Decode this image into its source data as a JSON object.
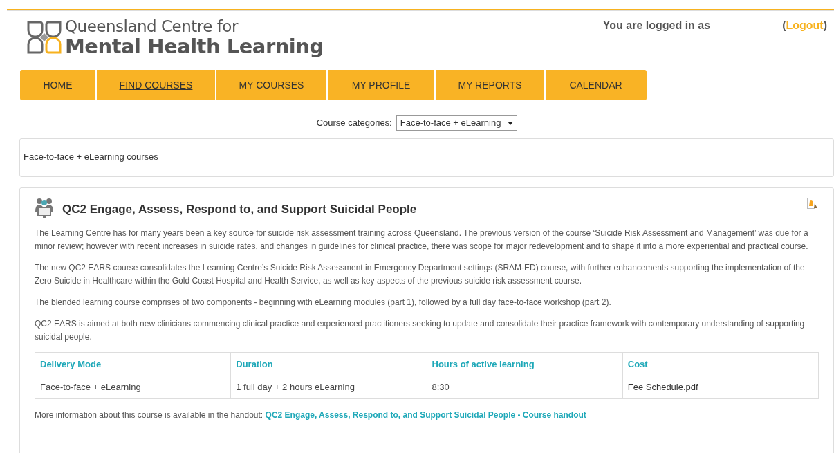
{
  "header": {
    "logo_line1": "Queensland Centre for",
    "logo_line2": "Mental Health Learning",
    "login_text": "You are logged in as",
    "logout_open": "(",
    "logout": "Logout",
    "logout_close": ")"
  },
  "nav": [
    {
      "label": "HOME",
      "selected": false
    },
    {
      "label": "FIND COURSES",
      "selected": true
    },
    {
      "label": "MY COURSES",
      "selected": false
    },
    {
      "label": "MY PROFILE",
      "selected": false
    },
    {
      "label": "MY REPORTS",
      "selected": false
    },
    {
      "label": "CALENDAR",
      "selected": false
    }
  ],
  "category": {
    "label": "Course categories:",
    "value": "Face-to-face + eLearning"
  },
  "category_box": {
    "text": "Face-to-face + eLearning courses"
  },
  "course": {
    "title": "QC2 Engage, Assess, Respond to, and Support Suicidal People",
    "paragraphs": [
      "The Learning Centre has for many years been a key source for suicide risk assessment training across Queensland. The previous version of the course ‘Suicide Risk Assessment and Management’ was due for a minor review; however with recent increases in suicide rates, and changes in guidelines for clinical practice, there was scope for major redevelopment and to shape it into a more experiential and practical course.",
      "The new QC2 EARS course consolidates the Learning Centre’s Suicide Risk Assessment in Emergency Department settings (SRAM-ED) course, with further enhancements supporting the implementation of the Zero Suicide in Healthcare within the Gold Coast Hospital and Health Service, as well as key aspects of the previous suicide risk assessment course.",
      "The blended learning course comprises of two components - beginning with eLearning modules (part 1), followed by a full day face-to-face workshop (part 2).",
      "QC2 EARS is aimed at both new clinicians commencing clinical practice and experienced practitioners seeking to update and consolidate their practice framework with contemporary understanding of supporting suicidal people."
    ],
    "table": {
      "columns": [
        "Delivery Mode",
        "Duration",
        "Hours of active learning",
        "Cost"
      ],
      "rows": [
        [
          {
            "text": "Face-to-face + eLearning",
            "kind": "text"
          },
          {
            "text": "1 full day + 2 hours eLearning",
            "kind": "text"
          },
          {
            "text": "8:30",
            "kind": "text"
          },
          {
            "text": "Fee Schedule.pdf",
            "kind": "link"
          }
        ]
      ]
    },
    "handout_text": "More information about this course is available in the handout:",
    "handout_link": "QC2 Engage, Assess, Respond to, and Support Suicidal People - Course handout"
  }
}
